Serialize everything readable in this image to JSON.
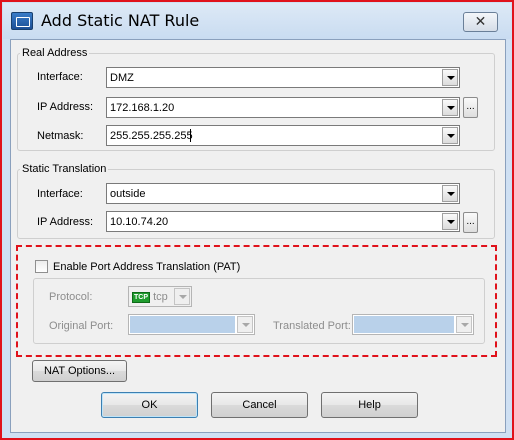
{
  "window": {
    "title": "Add Static NAT Rule",
    "close_glyph": "✕"
  },
  "real_address": {
    "legend": "Real Address",
    "interface_label": "Interface:",
    "interface_value": "DMZ",
    "ip_label": "IP Address:",
    "ip_value": "172.168.1.20",
    "netmask_label": "Netmask:",
    "netmask_value": "255.255.255.255"
  },
  "static_translation": {
    "legend": "Static Translation",
    "interface_label": "Interface:",
    "interface_value": "outside",
    "ip_label": "IP Address:",
    "ip_value": "10.10.74.20"
  },
  "pat": {
    "checkbox_label": "Enable Port Address Translation (PAT)",
    "checked": false,
    "protocol_label": "Protocol:",
    "protocol_icon": "TCP",
    "protocol_value": "tcp",
    "original_port_label": "Original Port:",
    "translated_port_label": "Translated Port:"
  },
  "buttons": {
    "browse": "...",
    "nat_options": "NAT Options...",
    "ok": "OK",
    "cancel": "Cancel",
    "help": "Help"
  },
  "colors": {
    "annotation_red": "#e0121b",
    "disabled_field": "#b9d1ea"
  }
}
